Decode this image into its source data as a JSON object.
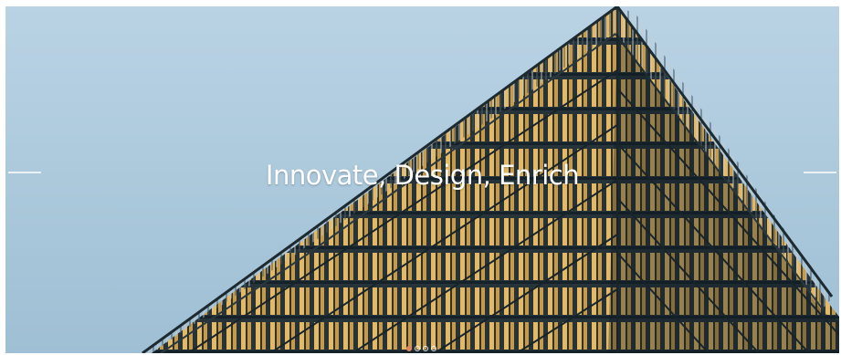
{
  "hero": {
    "headline": "Innovate, Design, Enrich",
    "image_subject": "modern building facade with golden vertical louvers against blue sky",
    "slides_total": 4,
    "active_slide": 1,
    "colors": {
      "sky": "#a9c6da",
      "louver": "#e0b35e",
      "frame": "#1c2a30",
      "dot_active": "#e2875f"
    }
  },
  "controls": {
    "prev_icon": "arrow-left-icon",
    "next_icon": "arrow-right-icon"
  }
}
